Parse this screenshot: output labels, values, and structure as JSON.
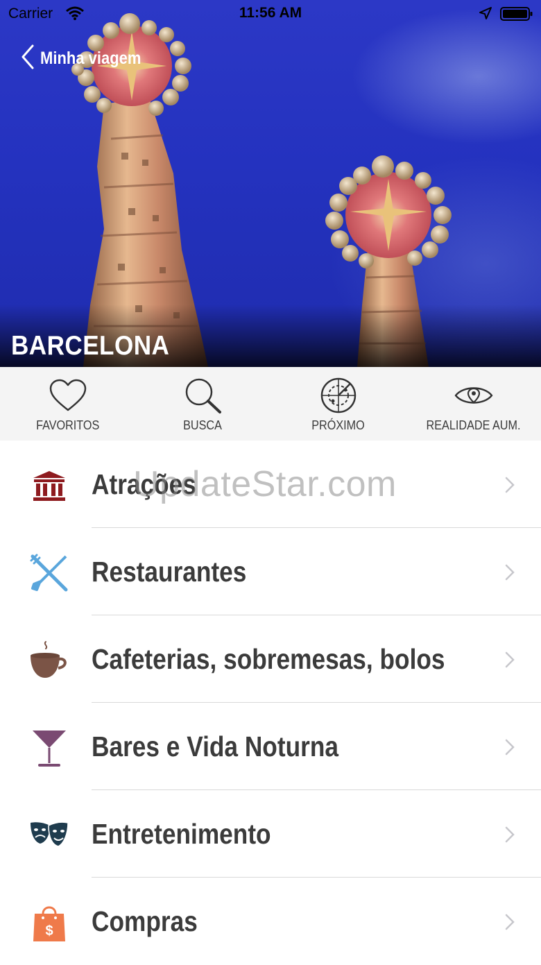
{
  "status_bar": {
    "carrier": "Carrier",
    "time": "11:56 AM",
    "icons": [
      "wifi-icon",
      "location-arrow-icon",
      "battery-icon"
    ]
  },
  "nav": {
    "back_label": "Minha viagem",
    "back_icon": "chevron-left-icon"
  },
  "hero": {
    "title": "BARCELONA"
  },
  "toolbar": {
    "items": [
      {
        "label": "FAVORITOS",
        "icon": "heart-icon"
      },
      {
        "label": "BUSCA",
        "icon": "search-icon"
      },
      {
        "label": "PRÓXIMO",
        "icon": "radar-icon"
      },
      {
        "label": "REALIDADE AUM.",
        "icon": "eye-icon"
      }
    ]
  },
  "categories": [
    {
      "label": "Atrações",
      "icon": "museum-icon",
      "color": "#8e1b1f"
    },
    {
      "label": "Restaurantes",
      "icon": "fork-knife-icon",
      "color": "#5aa6dc"
    },
    {
      "label": "Cafeterias, sobremesas, bolos",
      "icon": "coffee-cup-icon",
      "color": "#7b5446"
    },
    {
      "label": "Bares e Vida Noturna",
      "icon": "cocktail-glass-icon",
      "color": "#7a4a72"
    },
    {
      "label": "Entretenimento",
      "icon": "theater-masks-icon",
      "color": "#1f3c4e"
    },
    {
      "label": "Compras",
      "icon": "shopping-bag-icon",
      "color": "#ef7a4a"
    }
  ],
  "watermark": "UpdateStar.com"
}
